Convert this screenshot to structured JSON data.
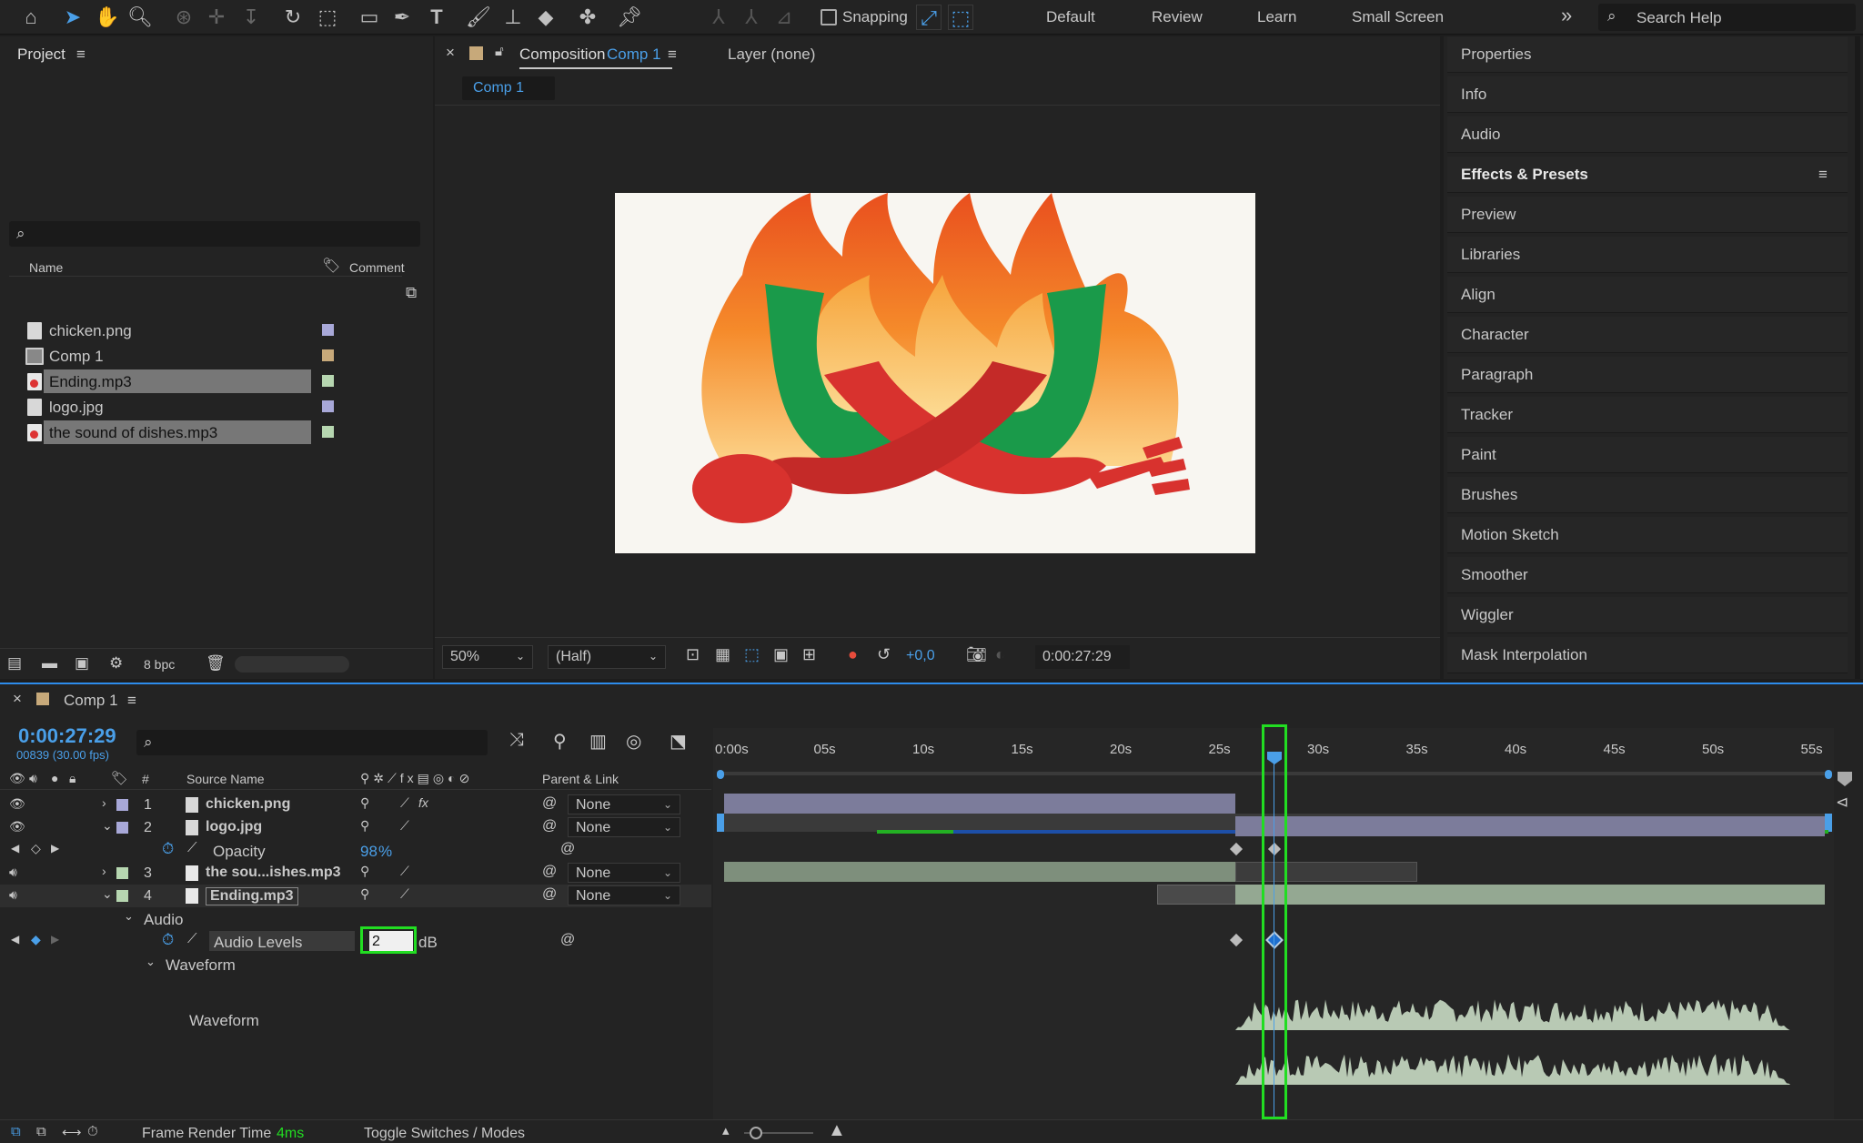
{
  "toolbar": {
    "snapping_label": "Snapping",
    "workspaces": [
      "Default",
      "Review",
      "Learn",
      "Small Screen"
    ],
    "more": "»",
    "search_placeholder": "Search Help"
  },
  "project": {
    "title": "Project",
    "menu_icon": "hamburger-icon",
    "search_placeholder": "",
    "columns": {
      "name": "Name",
      "comment": "Comment"
    },
    "items": [
      {
        "name": "chicken.png",
        "type": "image",
        "swatch": "#a8a8d8",
        "selected": false
      },
      {
        "name": "Comp 1",
        "type": "composition",
        "swatch": "#c7a97a",
        "selected": false
      },
      {
        "name": "Ending.mp3",
        "type": "audio",
        "swatch": "#b6d6b0",
        "selected": true
      },
      {
        "name": "logo.jpg",
        "type": "image",
        "swatch": "#a8a8d8",
        "selected": false
      },
      {
        "name": "the sound of dishes.mp3",
        "type": "audio",
        "swatch": "#b6d6b0",
        "selected": true
      }
    ],
    "bpc": "8 bpc"
  },
  "composition": {
    "tab_prefix": "Composition",
    "tab_name": "Comp 1",
    "layer_tab": "Layer (none)",
    "sub_tab": "Comp 1",
    "zoom": "50%",
    "resolution": "(Half)",
    "exposure": "+0,0",
    "timecode": "0:00:27:29"
  },
  "right_panel": {
    "items": [
      "Properties",
      "Info",
      "Audio",
      "Effects & Presets",
      "Preview",
      "Libraries",
      "Align",
      "Character",
      "Paragraph",
      "Tracker",
      "Paint",
      "Brushes",
      "Motion Sketch",
      "Smoother",
      "Wiggler",
      "Mask Interpolation"
    ],
    "active": "Effects & Presets"
  },
  "timeline": {
    "tab": "Comp 1",
    "timecode": "0:00:27:29",
    "frame_info": "00839 (30.00 fps)",
    "columns": {
      "num": "#",
      "source": "Source Name",
      "parent": "Parent & Link"
    },
    "ruler": [
      "0:00s",
      "05s",
      "10s",
      "15s",
      "20s",
      "25s",
      "30s",
      "35s",
      "40s",
      "45s",
      "50s",
      "55s"
    ],
    "layers": [
      {
        "num": "1",
        "name": "chicken.png",
        "parent": "None",
        "swatch": "#a8a8d8"
      },
      {
        "num": "2",
        "name": "logo.jpg",
        "parent": "None",
        "swatch": "#a8a8d8"
      },
      {
        "num": "3",
        "name": "the sou...ishes.mp3",
        "parent": "None",
        "swatch": "#b6d6b0"
      },
      {
        "num": "4",
        "name": "Ending.mp3",
        "parent": "None",
        "swatch": "#b6d6b0"
      }
    ],
    "opacity": {
      "label": "Opacity",
      "value": "98",
      "unit": "%"
    },
    "audio_group": "Audio",
    "audio_levels": {
      "label": "Audio Levels",
      "value": "2",
      "unit": "dB"
    },
    "waveform_group": "Waveform",
    "waveform_label": "Waveform",
    "status": {
      "render_label": "Frame Render Time",
      "render_value": "4ms",
      "toggle": "Toggle Switches / Modes"
    }
  },
  "colors": {
    "accent": "#2d8ceb",
    "highlight": "#22dd22",
    "panel": "#232323"
  }
}
